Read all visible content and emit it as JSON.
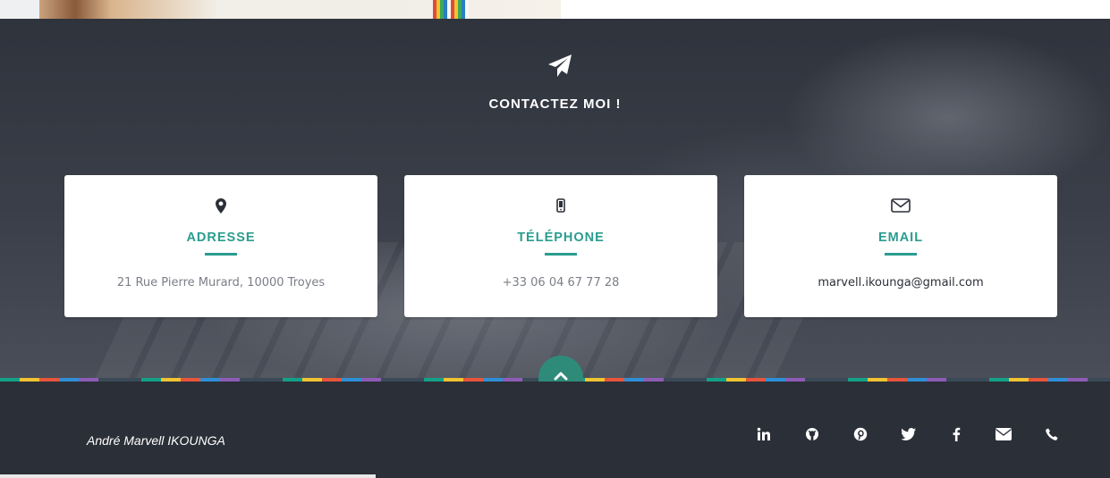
{
  "contact": {
    "title": "CONTACTEZ MOI !",
    "icon": "paper-plane-icon",
    "cards": [
      {
        "icon": "map-marker-icon",
        "title": "ADRESSE",
        "value": "21 Rue Pierre Murard, 10000 Troyes"
      },
      {
        "icon": "mobile-phone-icon",
        "title": "TÉLÉPHONE",
        "value": "+33 06 04 67 77 28"
      },
      {
        "icon": "envelope-icon",
        "title": "EMAIL",
        "value": "marvell.ikounga@gmail.com"
      }
    ]
  },
  "scroll_top": {
    "icon": "chevron-up-icon"
  },
  "footer": {
    "author": "André Marvell IKOUNGA",
    "social": [
      {
        "icon": "linkedin-icon"
      },
      {
        "icon": "github-icon"
      },
      {
        "icon": "pinterest-icon"
      },
      {
        "icon": "twitter-icon"
      },
      {
        "icon": "facebook-icon"
      },
      {
        "icon": "envelope-icon"
      },
      {
        "icon": "phone-icon"
      }
    ]
  },
  "colors": {
    "accent": "#2a9d8f",
    "dark_background": "#2b2f38",
    "scroll_button": "#2e8b7a"
  }
}
